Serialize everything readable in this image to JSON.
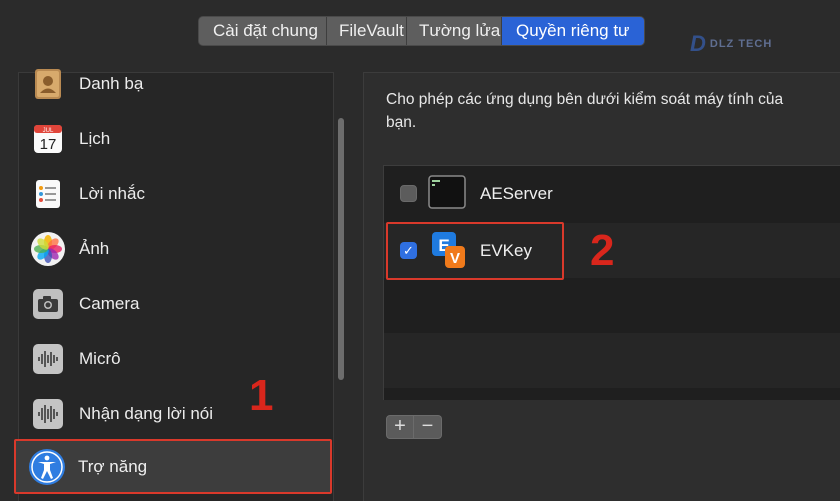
{
  "tabs": [
    {
      "label": "Cài đặt chung",
      "active": false
    },
    {
      "label": "FileVault",
      "active": false
    },
    {
      "label": "Tường lửa",
      "active": false
    },
    {
      "label": "Quyền riêng tư",
      "active": true
    }
  ],
  "watermark": {
    "mark": "D",
    "text": "DLZ TECH"
  },
  "sidebar": {
    "items": [
      {
        "label": "Danh bạ",
        "icon": "contacts-icon"
      },
      {
        "label": "Lịch",
        "icon": "calendar-icon",
        "calendar_day": "17",
        "calendar_month": "JUL"
      },
      {
        "label": "Lời nhắc",
        "icon": "reminders-icon"
      },
      {
        "label": "Ảnh",
        "icon": "photos-icon"
      },
      {
        "label": "Camera",
        "icon": "camera-icon"
      },
      {
        "label": "Micrô",
        "icon": "microphone-icon"
      },
      {
        "label": "Nhận dạng lời nói",
        "icon": "speech-recognition-icon"
      },
      {
        "label": "Trợ năng",
        "icon": "accessibility-icon",
        "selected": true
      }
    ]
  },
  "annotations": {
    "step1": "1",
    "step2": "2"
  },
  "main": {
    "description": "Cho phép các ứng dụng bên dưới kiểm soát máy tính của bạn.",
    "apps": [
      {
        "name": "AEServer",
        "checked": false,
        "icon": "terminal-icon"
      },
      {
        "name": "EVKey",
        "checked": true,
        "icon": "evkey-icon"
      }
    ],
    "add_label": "+",
    "remove_label": "−"
  },
  "colors": {
    "accent": "#2a63d6",
    "highlight": "#d9392b"
  }
}
